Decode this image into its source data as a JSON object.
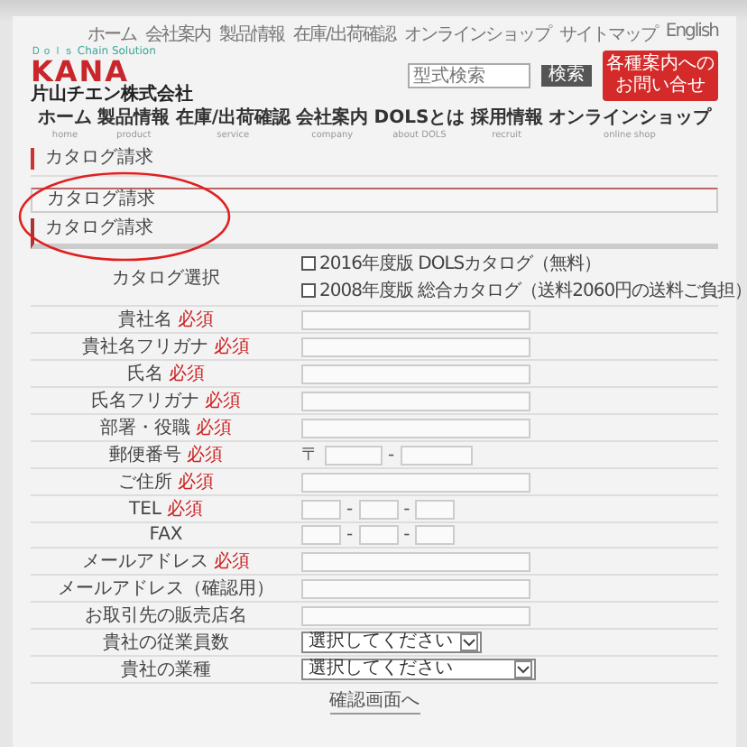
{
  "top_nav": [
    "ホーム",
    "会社案内",
    "製品情報",
    "在庫/出荷確認",
    "オンラインショップ",
    "サイトマップ",
    "English"
  ],
  "logo": {
    "tagline": "Ｄｏｌｓ Chain Solution",
    "name": "KANA",
    "company": "片山チエン株式会社"
  },
  "search": {
    "placeholder": "型式検索",
    "button": "検索"
  },
  "contact_button": "各種案内へのお問い合せ",
  "main_nav": [
    {
      "label": "ホーム",
      "sub": "home"
    },
    {
      "label": "製品情報",
      "sub": "product"
    },
    {
      "label": "在庫/出荷確認",
      "sub": "service"
    },
    {
      "label": "会社案内",
      "sub": "company"
    },
    {
      "label": "DOLSとは",
      "sub": "about DOLS"
    },
    {
      "label": "採用情報",
      "sub": "recruit"
    },
    {
      "label": "オンラインショップ",
      "sub": "online shop"
    }
  ],
  "page_title": "カタログ請求",
  "section_box": "カタログ請求",
  "section_heading": "カタログ請求",
  "catalog": {
    "label": "カタログ選択",
    "options": [
      {
        "text": "2016年度版 DOLSカタログ（無料）",
        "checked": false
      },
      {
        "text": "2008年度版 総合カタログ（送料2060円の送料ご負担）",
        "checked": false
      }
    ]
  },
  "rows": [
    {
      "label": "貴社名",
      "badge": "必須",
      "kind": "text"
    },
    {
      "label": "貴社名フリガナ",
      "badge": "必須",
      "kind": "text"
    },
    {
      "label": "氏名",
      "badge": "必須",
      "kind": "text"
    },
    {
      "label": "氏名フリガナ",
      "badge": "必須",
      "kind": "text"
    },
    {
      "label": "部署・役職",
      "badge": "必須",
      "kind": "text"
    },
    {
      "label": "郵便番号",
      "badge": "必須",
      "kind": "zip",
      "prefix": "〒",
      "separator": "-"
    },
    {
      "label": "ご住所",
      "badge": "必須",
      "kind": "text"
    },
    {
      "label": "TEL",
      "badge": "必須",
      "kind": "tel",
      "separator": "-"
    },
    {
      "label": "FAX",
      "kind": "tel",
      "separator": "-"
    },
    {
      "label": "メールアドレス",
      "badge": "必須",
      "kind": "text"
    },
    {
      "label": "メールアドレス（確認用）",
      "kind": "text"
    },
    {
      "label": "お取引先の販売店名",
      "kind": "text"
    },
    {
      "label": "貴社の従業員数",
      "kind": "select",
      "value": "選択してください",
      "wide": false
    },
    {
      "label": "貴社の業種",
      "kind": "select",
      "value": "選択してください",
      "wide": true
    }
  ],
  "submit": "確認画面へ"
}
